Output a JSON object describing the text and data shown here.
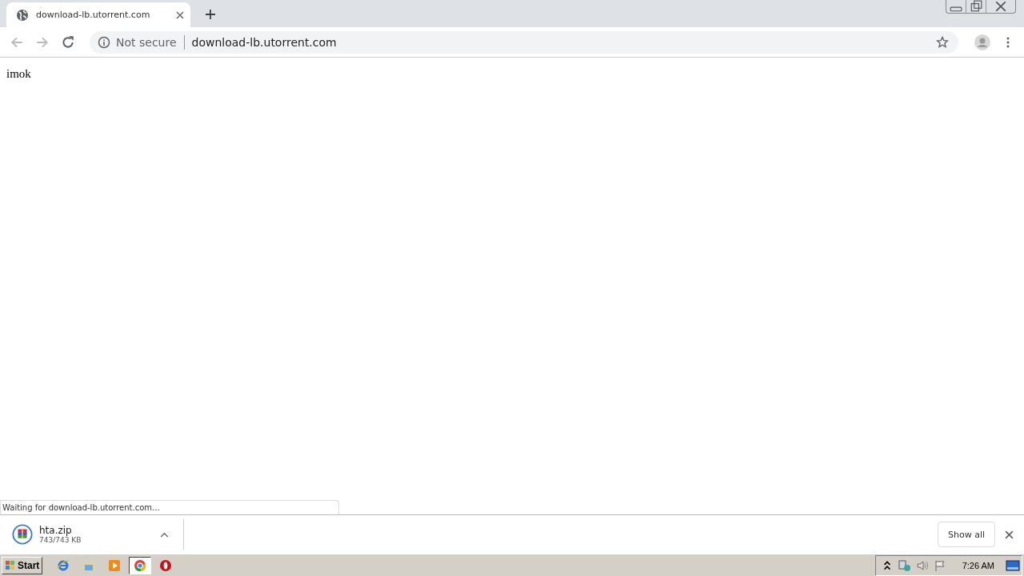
{
  "tabs": [
    {
      "title": "download-lb.utorrent.com",
      "selected": true
    }
  ],
  "address_bar": {
    "security": "Not secure",
    "url": "download-lb.utorrent.com"
  },
  "page": {
    "text": "imok"
  },
  "status_bubble": "Waiting for download-lb.utorrent.com...",
  "download_bar": {
    "items": [
      {
        "name": "hta.zip",
        "progress": "743/743 KB"
      }
    ],
    "show_all": "Show all"
  },
  "taskbar": {
    "start": "Start",
    "apps": [
      {
        "kind": "ie",
        "selected": false
      },
      {
        "kind": "explorer",
        "selected": false
      },
      {
        "kind": "media",
        "selected": false
      },
      {
        "kind": "chrome",
        "selected": true
      },
      {
        "kind": "opera",
        "selected": false
      }
    ],
    "clock": "7:26 AM"
  }
}
